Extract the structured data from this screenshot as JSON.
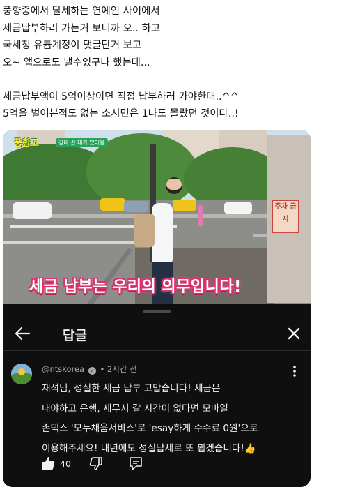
{
  "tweet": {
    "lines": [
      "풍향중에서 탈세하는 연예인 사이에서",
      "세금납부하러 가는거 보니까 오.. 하고",
      "국세청 유튭계정이 댓글단거 보고",
      "오~ 앱으로도 낼수있구나 했는데...",
      "",
      "세금납부액이 5억이상이면 직접 납부하러 가야한대..^^",
      "5억을 벌어본적도 없는 소시민은 1나도 몰랐던 것이다..!"
    ]
  },
  "video": {
    "show_logo": "풍향고",
    "show_tag": "강바 갈 대가 있어용",
    "sign": "주차 금지",
    "caption": "세금 납부는 우리의 의무입니다!"
  },
  "reply_panel": {
    "title": "답글",
    "comment": {
      "handle": "@ntskorea",
      "time": "• 2시간 전",
      "lines": [
        "재석님, 성실한 세금 납부 고맙습니다! 세금은",
        "내야하고 은행, 세무서 갈 시간이 없다면 모바일",
        "손택스 '모두채움서비스'로 'esay하게 수수료 0원'으로",
        "이용해주세요! 내년에도 성실납세로 또 뵙겠습니다!👍"
      ],
      "likes": "40"
    }
  },
  "icons": {
    "back": "arrow-left-icon",
    "close": "close-icon",
    "more": "more-vertical-icon",
    "like": "thumbs-up-icon",
    "dislike": "thumbs-down-icon",
    "reply": "reply-icon",
    "verified": "verified-icon"
  },
  "colors": {
    "panel_bg": "#0f0f0f",
    "caption_outline": "#d8336d",
    "text_light": "#f1f1f1",
    "text_muted": "#aaaaaa"
  }
}
